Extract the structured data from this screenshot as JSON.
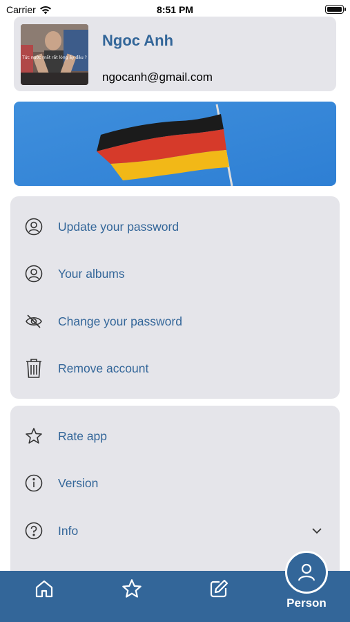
{
  "status_bar": {
    "carrier": "Carrier",
    "time": "8:51 PM"
  },
  "profile": {
    "name": "Ngoc Anh",
    "email": "ngocanh@gmail.com",
    "avatar_caption": "Tức nước mất rất lòng ấy đâu ?"
  },
  "account_menu": [
    {
      "label": "Update your password",
      "icon": "person-circle-icon"
    },
    {
      "label": "Your albums",
      "icon": "person-circle-icon"
    },
    {
      "label": "Change your password",
      "icon": "eye-slash-icon"
    },
    {
      "label": "Remove account",
      "icon": "trash-icon"
    }
  ],
  "app_menu": [
    {
      "label": "Rate app",
      "icon": "star-icon"
    },
    {
      "label": "Version",
      "icon": "info-circle-icon"
    },
    {
      "label": "Info",
      "icon": "question-circle-icon",
      "accessory": "chevron-down-icon"
    }
  ],
  "tab_bar": {
    "tabs": [
      {
        "icon": "home-icon"
      },
      {
        "icon": "star-icon"
      },
      {
        "icon": "edit-icon"
      },
      {
        "icon": "person-icon",
        "label": "Person",
        "selected": true
      }
    ]
  },
  "colors": {
    "accent": "#336699",
    "card_background": "#e5e5ea"
  }
}
